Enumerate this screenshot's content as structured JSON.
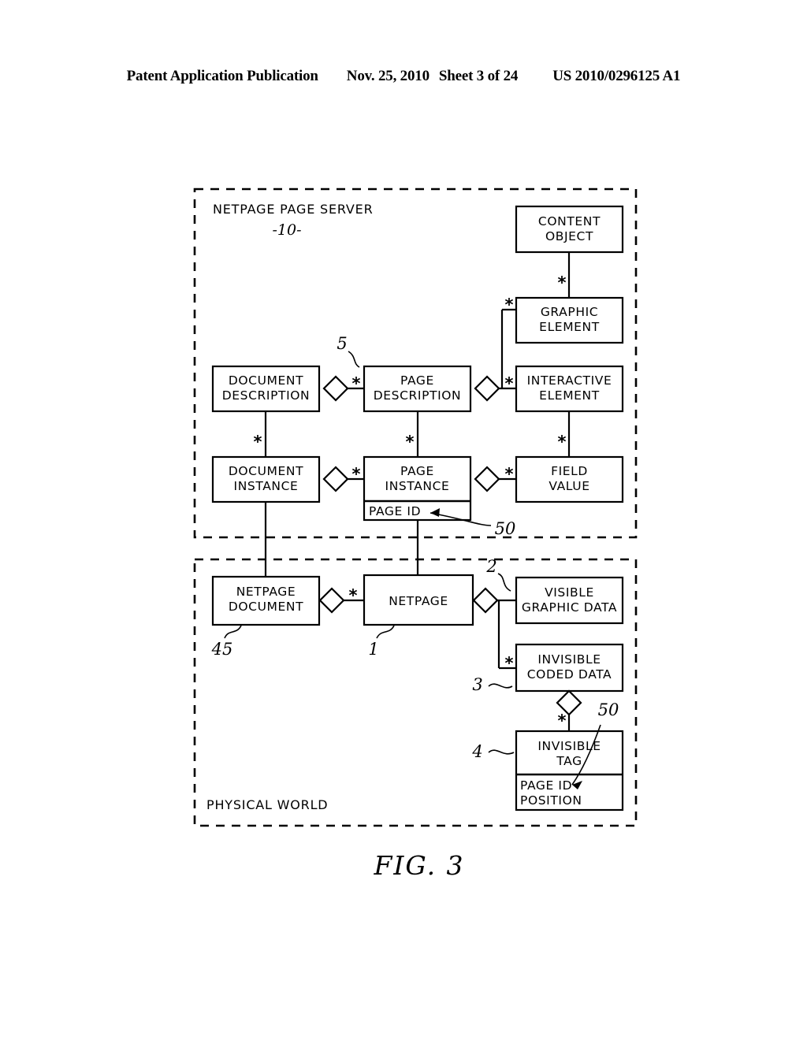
{
  "header": {
    "publication": "Patent Application Publication",
    "date": "Nov. 25, 2010",
    "sheet": "Sheet 3 of 24",
    "number": "US 2010/0296125 A1"
  },
  "figure": {
    "caption": "FIG. 3",
    "regions": [
      {
        "id": "server",
        "label": "NETPAGE PAGE SERVER",
        "ref": "-10-"
      },
      {
        "id": "physical",
        "label": "PHYSICAL WORLD",
        "ref": ""
      }
    ],
    "nodes": [
      {
        "id": "content-object",
        "line1": "CONTENT",
        "line2": "OBJECT"
      },
      {
        "id": "graphic-element",
        "line1": "GRAPHIC",
        "line2": "ELEMENT"
      },
      {
        "id": "interactive-element",
        "line1": "INTERACTIVE",
        "line2": "ELEMENT"
      },
      {
        "id": "field-value",
        "line1": "FIELD",
        "line2": "VALUE"
      },
      {
        "id": "document-description",
        "line1": "DOCUMENT",
        "line2": "DESCRIPTION"
      },
      {
        "id": "page-description",
        "line1": "PAGE",
        "line2": "DESCRIPTION"
      },
      {
        "id": "document-instance",
        "line1": "DOCUMENT",
        "line2": "INSTANCE"
      },
      {
        "id": "page-instance",
        "line1": "PAGE",
        "line2": "INSTANCE",
        "attribute1": "PAGE ID"
      },
      {
        "id": "netpage-document",
        "line1": "NETPAGE",
        "line2": "DOCUMENT"
      },
      {
        "id": "netpage",
        "line1": "NETPAGE",
        "line2": ""
      },
      {
        "id": "visible-graphic-data",
        "line1": "VISIBLE",
        "line2": "GRAPHIC DATA"
      },
      {
        "id": "invisible-coded-data",
        "line1": "INVISIBLE",
        "line2": "CODED DATA"
      },
      {
        "id": "invisible-tag",
        "line1": "INVISIBLE",
        "line2": "TAG",
        "attribute1": "PAGE ID",
        "attribute2": "POSITION"
      }
    ],
    "reference_numerals": [
      {
        "id": "ref-5",
        "value": "5",
        "target": "page-description"
      },
      {
        "id": "ref-50-pi",
        "value": "50",
        "target": "page-instance-page-id"
      },
      {
        "id": "ref-45",
        "value": "45",
        "target": "netpage-document"
      },
      {
        "id": "ref-1",
        "value": "1",
        "target": "netpage"
      },
      {
        "id": "ref-2",
        "value": "2",
        "target": "visible-graphic-data"
      },
      {
        "id": "ref-3",
        "value": "3",
        "target": "invisible-coded-data"
      },
      {
        "id": "ref-4",
        "value": "4",
        "target": "invisible-tag"
      },
      {
        "id": "ref-50-tag",
        "value": "50",
        "target": "invisible-tag-page-id"
      }
    ],
    "multiplicity_marks": [
      {
        "id": "m-content-graphic",
        "symbol": "*"
      },
      {
        "id": "m-graphic-page",
        "symbol": "*"
      },
      {
        "id": "m-interactive-page",
        "symbol": "*"
      },
      {
        "id": "m-pagedesc-docdesc",
        "symbol": "*"
      },
      {
        "id": "m-docinst-docdesc",
        "symbol": "*"
      },
      {
        "id": "m-pageinst-pagedesc",
        "symbol": "*"
      },
      {
        "id": "m-fieldval-interact",
        "symbol": "*"
      },
      {
        "id": "m-pageinst-docinst",
        "symbol": "*"
      },
      {
        "id": "m-fieldval-pageinst",
        "symbol": "*"
      },
      {
        "id": "m-netpage-npdoc",
        "symbol": "*"
      },
      {
        "id": "m-coded-netpage",
        "symbol": "*"
      },
      {
        "id": "m-tag-coded",
        "symbol": "*"
      }
    ],
    "colors": {
      "stroke": "#000000",
      "background": "#ffffff"
    }
  }
}
